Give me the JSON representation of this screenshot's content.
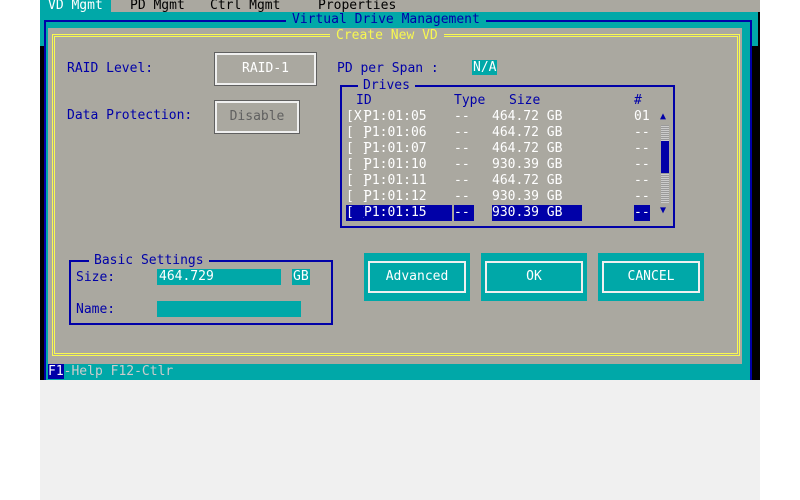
{
  "menu": {
    "tabs": [
      "VD Mgmt",
      "PD Mgmt",
      "Ctrl Mgmt",
      "Properties"
    ],
    "selected": 0
  },
  "window_title": "Virtual Drive Management",
  "dialog_title": "Create New VD",
  "raid_level": {
    "label": "RAID Level:",
    "value": "RAID-1"
  },
  "pd_per_span": {
    "label": "PD per Span :",
    "value": "N/A"
  },
  "data_protection": {
    "label": "Data Protection:",
    "value": "Disable"
  },
  "drives": {
    "title": "Drives",
    "headers": {
      "id": "ID",
      "type": "Type",
      "size": "Size",
      "num": "#"
    },
    "rows": [
      {
        "check": "[X]",
        "id": "P1:01:05",
        "type": "--",
        "size": "464.72 GB",
        "num": "01"
      },
      {
        "check": "[ ]",
        "id": "P1:01:06",
        "type": "--",
        "size": "464.72 GB",
        "num": "--"
      },
      {
        "check": "[ ]",
        "id": "P1:01:07",
        "type": "--",
        "size": "464.72 GB",
        "num": "--"
      },
      {
        "check": "[ ]",
        "id": "P1:01:10",
        "type": "--",
        "size": "930.39 GB",
        "num": "--"
      },
      {
        "check": "[ ]",
        "id": "P1:01:11",
        "type": "--",
        "size": "464.72 GB",
        "num": "--"
      },
      {
        "check": "[ ]",
        "id": "P1:01:12",
        "type": "--",
        "size": "930.39 GB",
        "num": "--"
      },
      {
        "check": "[ ]",
        "id": "P1:01:15",
        "type": "--",
        "size": "930.39 GB",
        "num": "--"
      }
    ],
    "selected": 6
  },
  "basic": {
    "title": "Basic Settings",
    "size_label": "Size:",
    "size_value": "464.729",
    "size_unit": "GB",
    "name_label": "Name:",
    "name_value": ""
  },
  "buttons": {
    "advanced": "Advanced",
    "ok": "OK",
    "cancel": "CANCEL"
  },
  "status": {
    "f1": "F1",
    "rest": "-Help F12-Ctlr"
  },
  "colors": {
    "teal": "#00a8a8",
    "blue": "#0000a8",
    "gray": "#aaa8a0",
    "yellow": "#f8f850"
  }
}
